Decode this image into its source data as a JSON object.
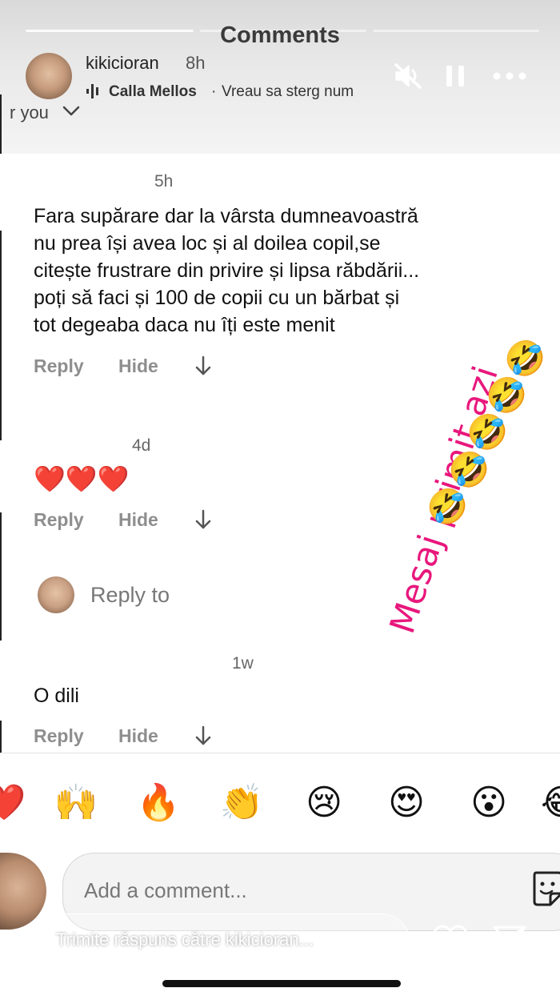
{
  "sheet": {
    "title": "Comments"
  },
  "story": {
    "username": "kikicioran",
    "time": "8h",
    "music": {
      "artist": "Calla Mellos",
      "separator": "·",
      "song": "Vreau sa sterg num"
    }
  },
  "filter": {
    "label": "r you"
  },
  "comments": [
    {
      "time": "5h",
      "lines": [
        "Fara supărare dar la vârsta dumneavoastră",
        "nu prea își avea loc și al doilea copil,se",
        "citește frustrare din privire și lipsa răbdării...",
        "poți să faci și 100 de copii cu un bărbat și",
        "tot degeaba daca nu îți este menit"
      ],
      "reply": "Reply",
      "hide": "Hide"
    },
    {
      "time": "4d",
      "text": "❤️❤️❤️",
      "reply": "Reply",
      "hide": "Hide"
    },
    {
      "time": "1w",
      "text": "O dili",
      "reply": "Reply",
      "hide": "Hide"
    }
  ],
  "reply_prompt": "Reply to",
  "quick_reactions": [
    "❤️",
    "🙌",
    "🔥",
    "👏",
    "😢",
    "😍",
    "😮",
    "😂"
  ],
  "composer": {
    "placeholder": "Add a comment..."
  },
  "story_reply": {
    "placeholder": "Trimite răspuns către kikicioran..."
  },
  "sticker": {
    "text": "Mesaj primit azi",
    "emoji": [
      "🤣",
      "🤣",
      "🤣",
      "🤣",
      "🤣"
    ],
    "color": "#e8177c"
  }
}
